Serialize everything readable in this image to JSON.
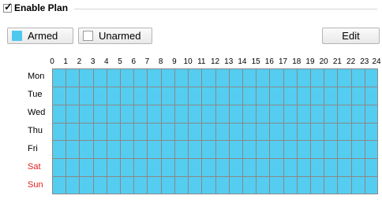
{
  "enable_plan": {
    "label": "Enable Plan",
    "checked": true
  },
  "legend": {
    "armed_label": "Armed",
    "unarmed_label": "Unarmed",
    "armed_color": "#4ec8ee",
    "unarmed_color": "#ffffff"
  },
  "edit_label": "Edit",
  "hours": [
    "0",
    "1",
    "2",
    "3",
    "4",
    "5",
    "6",
    "7",
    "8",
    "9",
    "10",
    "11",
    "12",
    "13",
    "14",
    "15",
    "16",
    "17",
    "18",
    "19",
    "20",
    "21",
    "22",
    "23",
    "24"
  ],
  "days": [
    {
      "label": "Mon",
      "color": "#000000"
    },
    {
      "label": "Tue",
      "color": "#000000"
    },
    {
      "label": "Wed",
      "color": "#000000"
    },
    {
      "label": "Thu",
      "color": "#000000"
    },
    {
      "label": "Fri",
      "color": "#000000"
    },
    {
      "label": "Sat",
      "color": "#e0201c"
    },
    {
      "label": "Sun",
      "color": "#e0201c"
    }
  ],
  "schedule": {
    "armed_color": "#55cdf0",
    "all_armed": true
  }
}
